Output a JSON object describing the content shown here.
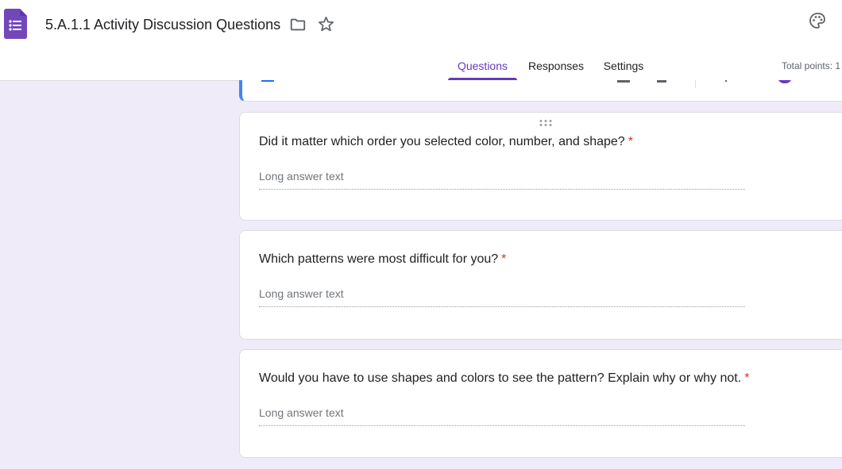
{
  "header": {
    "doc_title": "5.A.1.1 Activity Discussion Questions",
    "app_icon": "google-forms-icon",
    "brand_color": "#673ab7",
    "total_points_label": "Total points: 1"
  },
  "tabs": [
    {
      "label": "Questions",
      "active": true
    },
    {
      "label": "Responses",
      "active": false
    },
    {
      "label": "Settings",
      "active": false
    }
  ],
  "questions": [
    {
      "title": "Did it matter which order you selected color, number, and shape?",
      "required_mark": "*",
      "answer_placeholder": "Long answer text"
    },
    {
      "title": "Which patterns were most difficult for you?",
      "required_mark": "*",
      "answer_placeholder": "Long answer text"
    },
    {
      "title": "Would you have to use shapes and colors to see the pattern? Explain why or why not.",
      "required_mark": "*",
      "answer_placeholder": "Long answer text"
    }
  ],
  "colors": {
    "background": "#f0ebf8",
    "accent": "#673ab7",
    "focus_border": "#4285f4",
    "required": "#d93025"
  }
}
